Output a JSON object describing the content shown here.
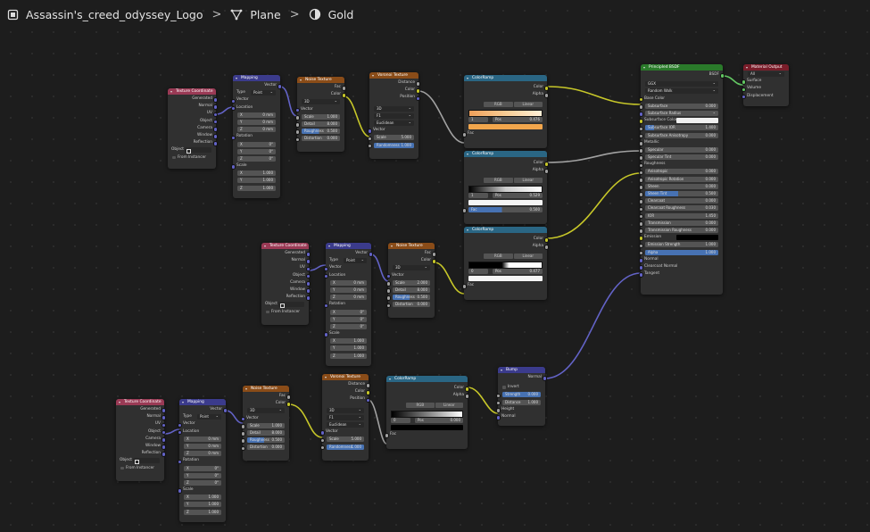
{
  "breadcrumb": {
    "object": "Assassin's_creed_odyssey_Logo",
    "mesh": "Plane",
    "material": "Gold"
  },
  "colors": {
    "texcoord": "#9a3a55",
    "mapping": "#3b3b8c",
    "texture": "#8a4c18",
    "converter": "#2a6684",
    "shader": "#2a7a2a",
    "output": "#7a1d2a"
  },
  "labels": {
    "texcoord_title": "Texture Coordinate",
    "generated": "Generated",
    "normal": "Normal",
    "uv": "UV",
    "object": "Object",
    "camera": "Camera",
    "window": "Window",
    "reflection": "Reflection",
    "from_instancer": "From Instancer",
    "mapping_title": "Mapping",
    "vector": "Vector",
    "type": "Type",
    "point": "Point",
    "location": "Location",
    "rotation": "Rotation",
    "scale": "Scale",
    "x": "X",
    "y": "Y",
    "z": "Z",
    "noise_title": "Noise Texture",
    "fac": "Fac",
    "color": "Color",
    "dim3d": "3D",
    "detail": "Detail",
    "roughness": "Roughness",
    "distortion": "Distortion",
    "voronoi_title": "Voronoi Texture",
    "distance": "Distance",
    "position": "Position",
    "f1": "F1",
    "euclidean": "Euclidean",
    "randomness": "Randomness",
    "colorramp_title": "ColorRamp",
    "alpha": "Alpha",
    "rgb": "RGB",
    "linear": "Linear",
    "pos": "Pos",
    "bump_title": "Bump",
    "invert": "Invert",
    "strength": "Strength",
    "height": "Height",
    "bsdf_title": "Principled BSDF",
    "bsdf": "BSDF",
    "ggx": "GGX",
    "random_walk": "Random Walk",
    "base_color": "Base Color",
    "subsurface": "Subsurface",
    "subsurface_radius": "Subsurface Radius",
    "subsurface_color": "Subsurface Color",
    "subsurface_ior": "Subsurface IOR",
    "subsurface_anisotropy": "Subsurface Anisotropy",
    "metallic": "Metallic",
    "specular": "Specular",
    "specular_tint": "Specular Tint",
    "anisotropic": "Anisotropic",
    "anisotropic_rotation": "Anisotropic Rotation",
    "sheen": "Sheen",
    "sheen_tint": "Sheen Tint",
    "clearcoat": "Clearcoat",
    "clearcoat_roughness": "Clearcoat Roughness",
    "ior": "IOR",
    "transmission": "Transmission",
    "transmission_roughness": "Transmission Roughness",
    "emission": "Emission",
    "emission_strength": "Emission Strength",
    "clearcoat_normal": "Clearcoat Normal",
    "tangent": "Tangent",
    "output_title": "Material Output",
    "all": "All",
    "surface": "Surface",
    "volume": "Volume",
    "displacement": "Displacement"
  },
  "values": {
    "zero_m": "0 mm",
    "zero_deg": "0°",
    "one": "1.000",
    "five": "5.000",
    "two": "2.000",
    "eight": "8.000",
    "half": "0.500",
    "zero": "0.000",
    "cr1_index": "1",
    "cr1_pos": "0.476",
    "cr2_index": "1",
    "cr2_pos": "0.529",
    "cr3_index": "0",
    "cr3_pos": "0.477",
    "cr4_index": "0",
    "cr4_pos": "0.000",
    "bump_dist": "1.000",
    "sss_r": "1.000",
    "sss_ior": "1.400",
    "spec": "0.500",
    "rough": "0.500",
    "ior_v": "1.450",
    "sheen_tint": "0.500",
    "clearcoat_r": "0.030",
    "emis_str": "1.000",
    "alpha_v": "1.000",
    "cr2_fac": "0.500"
  }
}
